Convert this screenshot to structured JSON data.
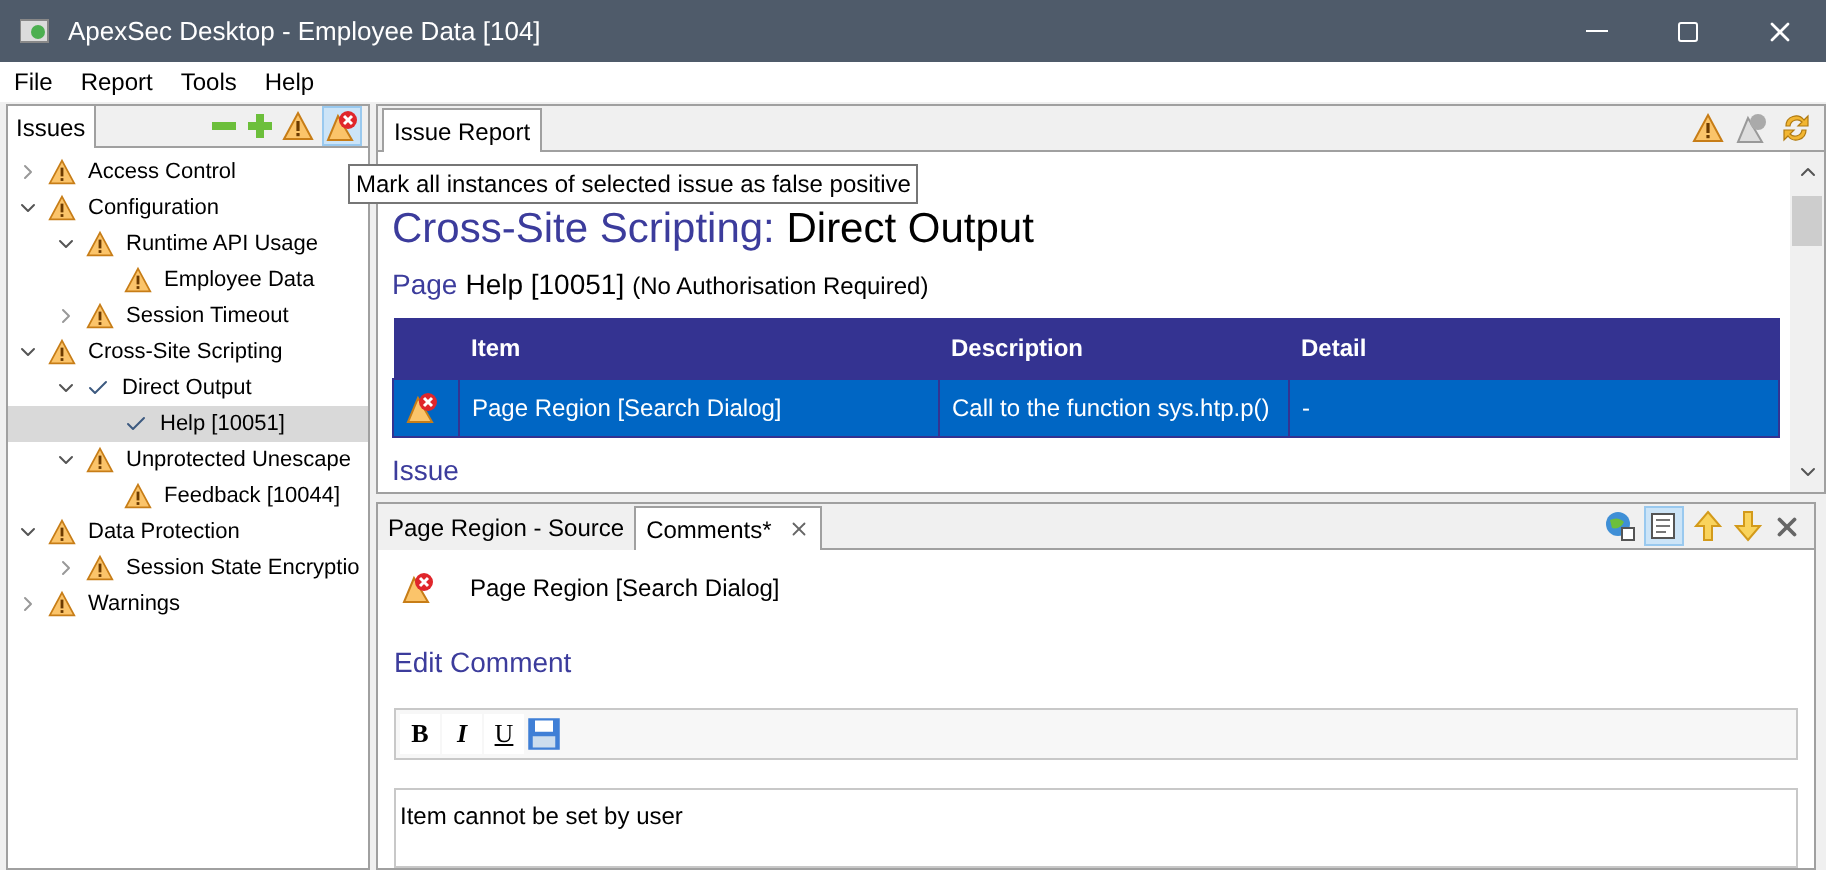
{
  "window": {
    "title": "ApexSec Desktop - Employee Data [104]"
  },
  "menu": [
    "File",
    "Report",
    "Tools",
    "Help"
  ],
  "issues_panel": {
    "tab": "Issues",
    "tooltip": "Mark all instances of selected issue as false positive"
  },
  "tree": [
    {
      "label": "Access Control",
      "kind": "warning",
      "expanded": false,
      "selected": false
    },
    {
      "label": "Configuration",
      "kind": "warning",
      "expanded": true,
      "selected": false,
      "children": [
        {
          "label": "Runtime API Usage",
          "kind": "warning",
          "expanded": true,
          "selected": false,
          "children": [
            {
              "label": "Employee Data",
              "kind": "warning",
              "selected": false
            }
          ]
        },
        {
          "label": "Session Timeout",
          "kind": "warning",
          "expanded": false,
          "selected": false
        }
      ]
    },
    {
      "label": "Cross-Site Scripting",
      "kind": "warning",
      "expanded": true,
      "selected": false,
      "children": [
        {
          "label": "Direct Output",
          "kind": "check",
          "expanded": true,
          "selected": false,
          "children": [
            {
              "label": "Help [10051]",
              "kind": "check",
              "selected": true
            }
          ]
        },
        {
          "label": "Unprotected Unescape",
          "kind": "warning",
          "expanded": true,
          "selected": false,
          "children": [
            {
              "label": "Feedback [10044]",
              "kind": "warning",
              "selected": false
            }
          ]
        }
      ]
    },
    {
      "label": "Data Protection",
      "kind": "warning",
      "expanded": true,
      "selected": false,
      "children": [
        {
          "label": "Session State Encryptio",
          "kind": "warning",
          "expanded": false,
          "selected": false
        }
      ]
    },
    {
      "label": "Warnings",
      "kind": "warning",
      "expanded": false,
      "selected": false
    }
  ],
  "report": {
    "tab": "Issue Report",
    "category": "Cross-Site Scripting:",
    "title": "Direct Output",
    "page_label": "Page",
    "page": "Help [10051]",
    "page_note": "(No Authorisation Required)",
    "columns": [
      "Item",
      "Description",
      "Detail"
    ],
    "rows": [
      {
        "item": "Page Region [Search Dialog]",
        "description": "Call to the function sys.htp.p()",
        "detail": "-",
        "false_positive": true,
        "selected": true
      }
    ],
    "section": "Issue"
  },
  "comments": {
    "tabs": [
      {
        "label": "Page Region - Source",
        "selected": false,
        "closable": false
      },
      {
        "label": "Comments*",
        "selected": true,
        "closable": true
      }
    ],
    "item": "Page Region [Search Dialog]",
    "heading": "Edit Comment",
    "format_buttons": [
      "B",
      "I",
      "U"
    ],
    "comment": "Item cannot be set by user"
  }
}
